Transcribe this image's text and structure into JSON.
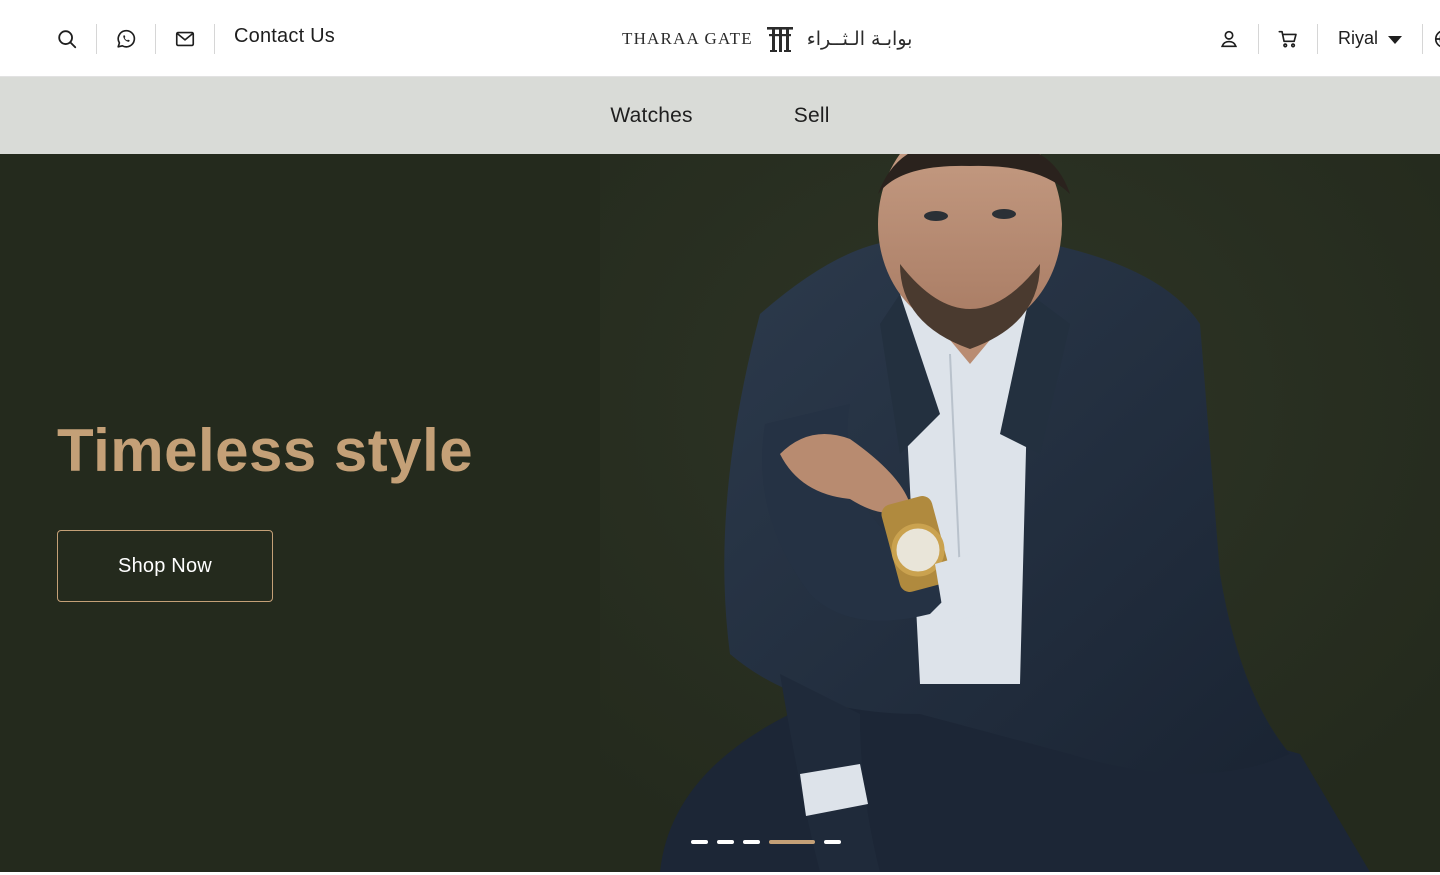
{
  "header": {
    "contact_label": "Contact Us",
    "logo": {
      "en": "THARAA GATE",
      "ar": "بوابـة الـثــراء"
    },
    "currency": "Riyal",
    "icons": {
      "search": "search-icon",
      "whatsapp": "whatsapp-icon",
      "mail": "mail-icon",
      "account": "user-icon",
      "cart": "cart-icon",
      "language": "globe-icon",
      "currency_caret": "caret-down-icon"
    }
  },
  "nav": {
    "items": [
      {
        "label": "Watches"
      },
      {
        "label": "Sell"
      }
    ]
  },
  "hero": {
    "title": "Timeless style",
    "cta_label": "Shop Now",
    "slides": {
      "count": 5,
      "active_index": 3
    }
  },
  "colors": {
    "hero_bg": "#242a1d",
    "accent_gold": "#c4a077",
    "nav_bg": "#d9dbd7",
    "text_dark": "#1e1e1e"
  }
}
